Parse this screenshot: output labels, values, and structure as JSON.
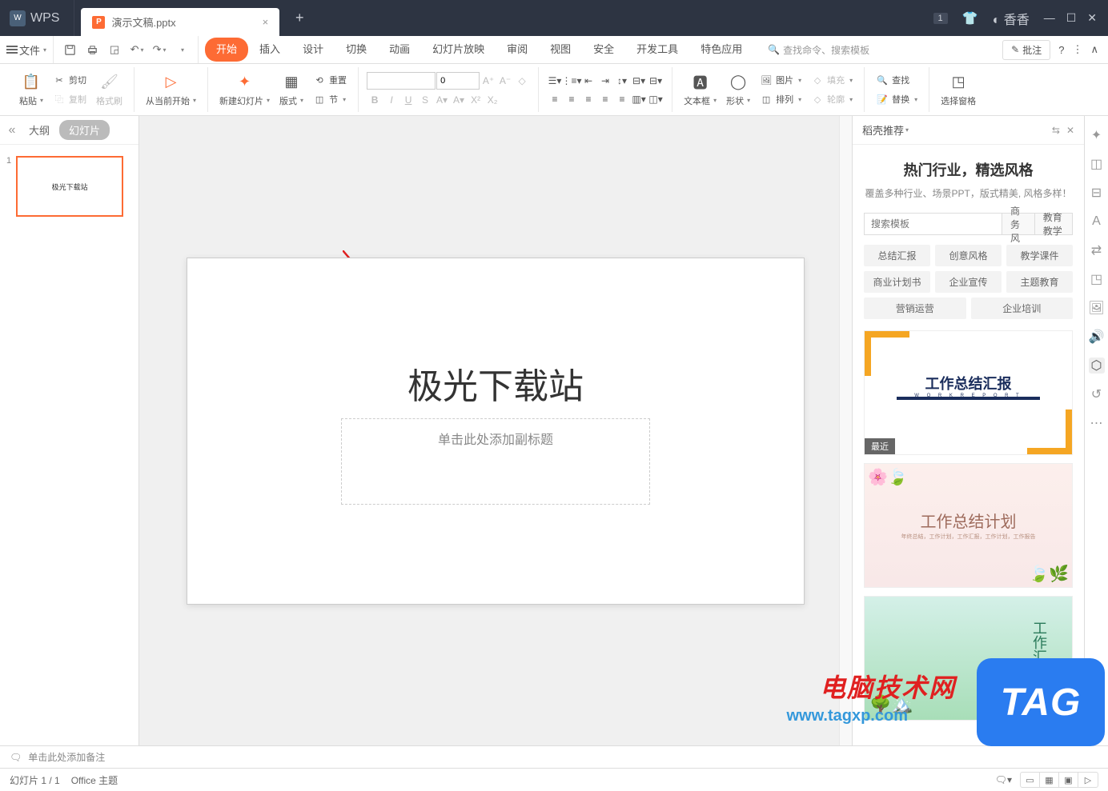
{
  "titlebar": {
    "wps_label": "WPS",
    "tab_name": "演示文稿.pptx",
    "badge": "1",
    "user": "香香"
  },
  "menubar": {
    "file": "文件",
    "tabs": [
      "开始",
      "插入",
      "设计",
      "切换",
      "动画",
      "幻灯片放映",
      "审阅",
      "视图",
      "安全",
      "开发工具",
      "特色应用"
    ],
    "search_placeholder": "查找命令、搜索模板",
    "annotation": "批注"
  },
  "ribbon": {
    "paste": "粘贴",
    "cut": "剪切",
    "copy": "复制",
    "format_painter": "格式刷",
    "from_current": "从当前开始",
    "new_slide": "新建幻灯片",
    "layout": "版式",
    "reset": "重置",
    "section": "节",
    "font_name": "",
    "font_size": "0",
    "text_box": "文本框",
    "shapes": "形状",
    "picture": "图片",
    "arrange": "排列",
    "fill": "填充",
    "outline": "轮廓",
    "find": "查找",
    "replace": "替换",
    "select_pane": "选择窗格"
  },
  "outline": {
    "outline_tab": "大纲",
    "slides_tab": "幻灯片",
    "thumb_num": "1",
    "thumb_text": "极光下载站"
  },
  "slide": {
    "title": "极光下载站",
    "subtitle": "单击此处添加副标题"
  },
  "right_pane": {
    "header": "稻壳推荐",
    "title": "热门行业，精选风格",
    "desc": "覆盖多种行业、场景PPT，版式精美, 风格多样！",
    "search_placeholder": "搜索模板",
    "search_btn1": "商务风",
    "search_btn2": "教育教学",
    "tags": [
      "总结汇报",
      "创意风格",
      "教学课件",
      "商业计划书",
      "企业宣传",
      "主题教育",
      "营销运营",
      "企业培训"
    ],
    "tpl1_title": "工作总结汇报",
    "tpl1_sub": "W O R K   R E P O R T",
    "tpl1_badge": "最近",
    "tpl2_title": "工作总结计划",
    "tpl2_sub": "年终总结，工作计划，工作汇报，工作计划，工作报告",
    "tpl3_title": "工作汇报"
  },
  "notes": {
    "placeholder": "单击此处添加备注"
  },
  "statusbar": {
    "slide_count": "幻灯片 1 / 1",
    "theme": "Office 主题"
  },
  "watermark": {
    "text1": "电脑技术网",
    "url": "www.tagxp.com",
    "tag": "TAG"
  }
}
